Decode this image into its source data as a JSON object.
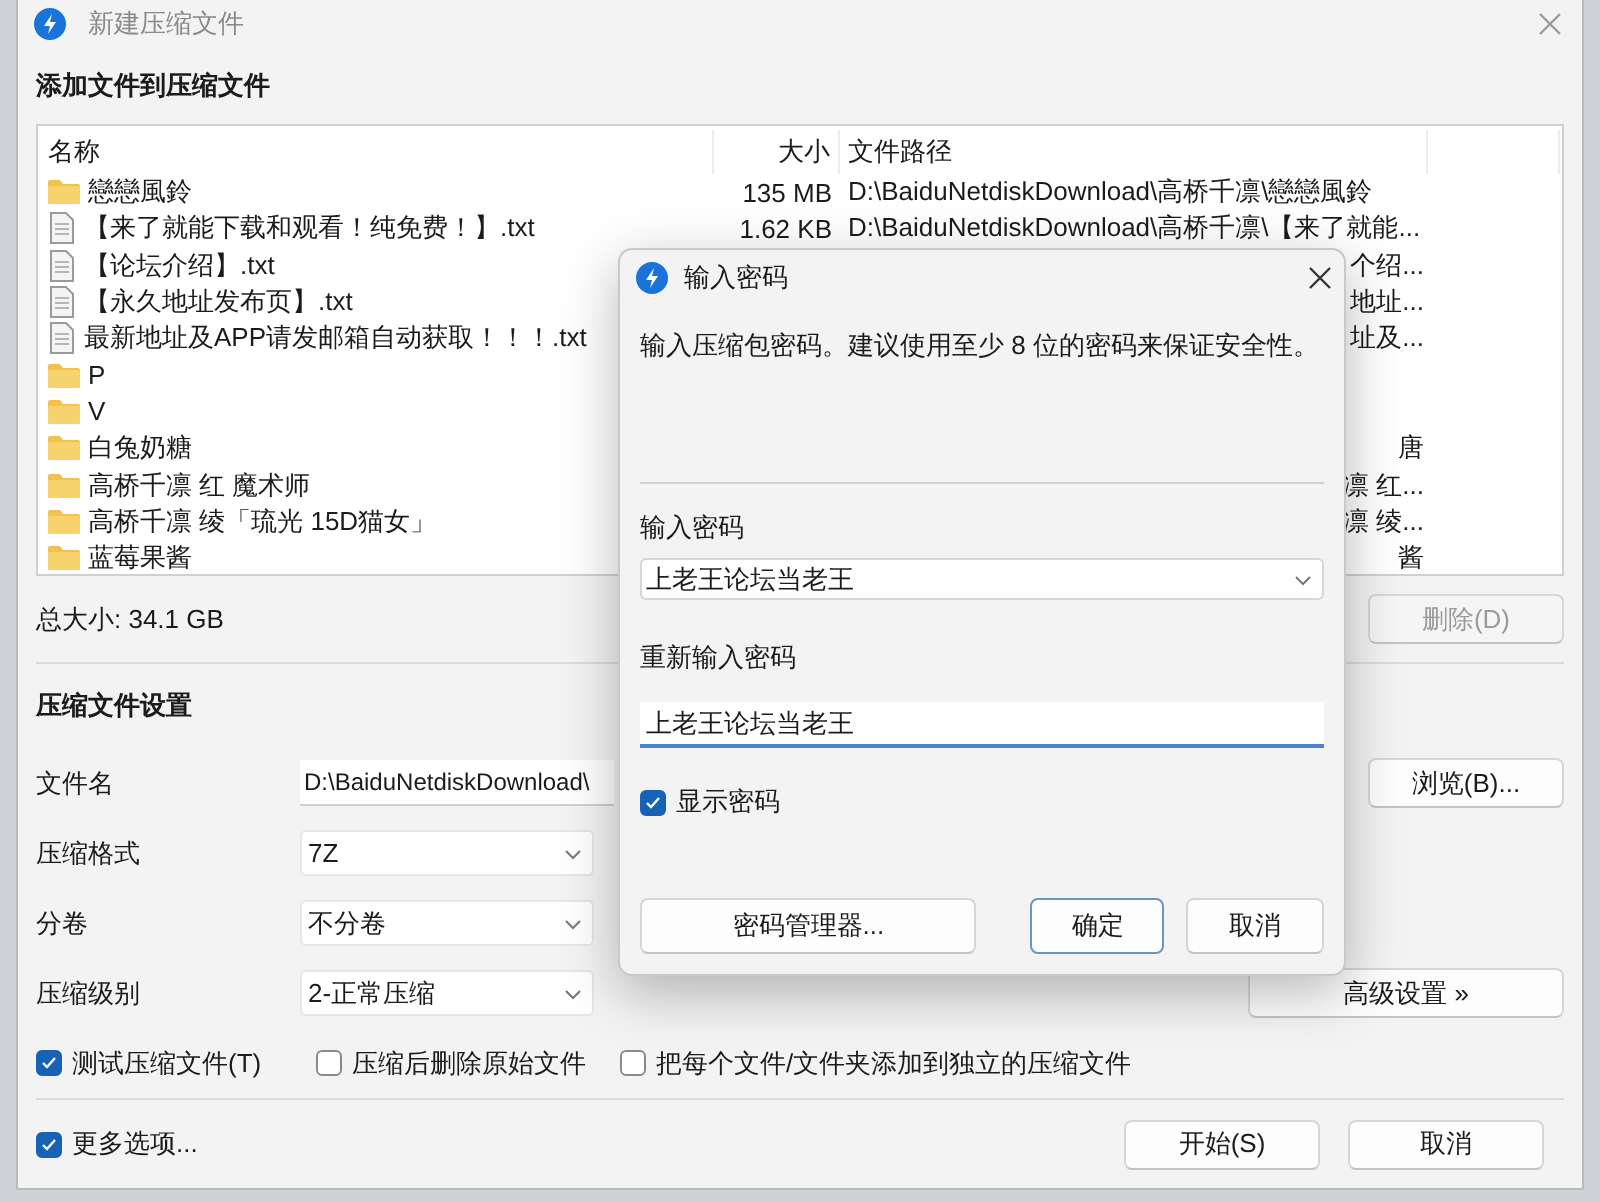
{
  "main_window": {
    "title": "新建压缩文件",
    "heading": "添加文件到压缩文件",
    "file_table": {
      "columns": [
        "名称",
        "大小",
        "文件路径"
      ],
      "rows": [
        {
          "kind": "folder",
          "name": "戀戀風鈴",
          "size": "135 MB",
          "path": "D:\\BaiduNetdiskDownload\\高桥千凛\\戀戀風鈴"
        },
        {
          "kind": "file",
          "name": "【来了就能下载和观看！纯免费！】.txt",
          "size": "1.62 KB",
          "path": "D:\\BaiduNetdiskDownload\\高桥千凛\\【来了就能..."
        },
        {
          "kind": "file",
          "name": "【论坛介绍】.txt",
          "path": "个绍..."
        },
        {
          "kind": "file",
          "name": "【永久地址发布页】.txt",
          "path": "地址..."
        },
        {
          "kind": "file",
          "name": "最新地址及APP请发邮箱自动获取！！！.txt",
          "path": "址及..."
        },
        {
          "kind": "folder",
          "name": "P"
        },
        {
          "kind": "folder",
          "name": "V"
        },
        {
          "kind": "folder",
          "name": "白兔奶糖",
          "path": "唐"
        },
        {
          "kind": "folder",
          "name": "高桥千凛 红  魔术师",
          "path": "凛 红..."
        },
        {
          "kind": "folder",
          "name": "高桥千凛 绫「琉光 15D猫女」",
          "path": "凛 绫..."
        },
        {
          "kind": "folder",
          "name": "蓝莓果酱",
          "path": "酱"
        }
      ]
    },
    "total_size": "总大小: 34.1 GB",
    "delete_button": {
      "label": "删除(D)",
      "disabled": true
    },
    "settings_heading": "压缩文件设置",
    "fields": [
      {
        "kind": "text",
        "label": "文件名",
        "value": "D:\\BaiduNetdiskDownload\\",
        "button": "浏览(B)..."
      },
      {
        "kind": "select",
        "label": "压缩格式",
        "value": "7Z"
      },
      {
        "kind": "select",
        "label": "分卷",
        "value": "不分卷"
      },
      {
        "kind": "select",
        "label": "压缩级别",
        "value": "2-正常压缩",
        "button": "高级设置 »"
      }
    ],
    "options": [
      {
        "label": "测试压缩文件(T)",
        "checked": true
      },
      {
        "label": "压缩后删除原始文件",
        "checked": false
      },
      {
        "label": "把每个文件/文件夹添加到独立的压缩文件",
        "checked": false
      }
    ],
    "more_options": {
      "label": "更多选项...",
      "checked": true
    },
    "buttons": [
      "开始(S)",
      "取消"
    ]
  },
  "password_dialog": {
    "title": "输入密码",
    "description": "输入压缩包密码。建议使用至少 8 位的密码来保证安全性。",
    "password_label": "输入密码",
    "password_value": "上老王论坛当老王",
    "confirm_label": "重新输入密码",
    "confirm_value": "上老王论坛当老王",
    "show_password": {
      "label": "显示密码",
      "checked": true
    },
    "buttons": [
      {
        "label": "密码管理器...",
        "default": false
      },
      {
        "label": "确定",
        "default": true
      },
      {
        "label": "取消",
        "default": false
      }
    ]
  }
}
